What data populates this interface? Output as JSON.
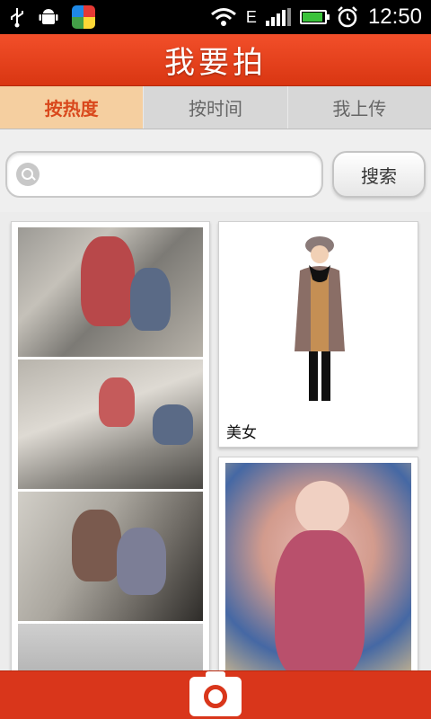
{
  "status_bar": {
    "time": "12:50",
    "network": "E",
    "icons": [
      "usb-icon",
      "android-icon",
      "app-icon",
      "wifi-icon",
      "signal-icon",
      "battery-icon",
      "alarm-icon"
    ]
  },
  "header": {
    "title": "我要拍"
  },
  "tabs": [
    {
      "label": "按热度",
      "active": true
    },
    {
      "label": "按时间",
      "active": false
    },
    {
      "label": "我上传",
      "active": false
    }
  ],
  "search": {
    "placeholder": "",
    "value": "",
    "button_label": "搜索"
  },
  "feed": {
    "right_items": [
      {
        "caption": "美女"
      },
      {
        "caption": ""
      }
    ]
  },
  "colors": {
    "brand": "#d9361b",
    "active_tab_bg": "#f5cfa0",
    "active_tab_text": "#d9481c"
  },
  "bottom_bar": {
    "action_icon": "camera-icon"
  }
}
